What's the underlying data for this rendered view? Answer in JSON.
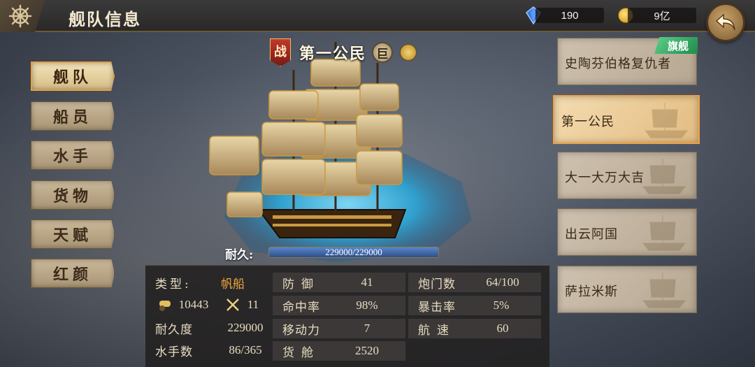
{
  "header": {
    "title": "舰队信息",
    "gems": "190",
    "gold": "9亿"
  },
  "tabs": [
    {
      "label": "舰队",
      "active": true
    },
    {
      "label": "船员",
      "active": false
    },
    {
      "label": "水手",
      "active": false
    },
    {
      "label": "货物",
      "active": false
    },
    {
      "label": "天赋",
      "active": false
    },
    {
      "label": "红颜",
      "active": false
    }
  ],
  "ship": {
    "battle_badge": "战",
    "name": "第一公民",
    "size_badge": "巨",
    "durability_label": "耐久:",
    "durability_text": "229000/229000",
    "durability_fraction": 1.0
  },
  "stats": {
    "type_label": "类型:",
    "type_value": "帆船",
    "power_value": "10443",
    "attack_value": "11",
    "durability_label": "耐久度",
    "durability_value": "229000",
    "sailors_label": "水手数",
    "sailors_value": "86/365",
    "defense_label": "防御",
    "defense_value": "41",
    "hit_label": "命中率",
    "hit_value": "98%",
    "move_label": "移动力",
    "move_value": "7",
    "cargo_label": "货舱",
    "cargo_value": "2520",
    "cannon_label": "炮门数",
    "cannon_value": "64/100",
    "crit_label": "暴击率",
    "crit_value": "5%",
    "speed_label": "航速",
    "speed_value": "60"
  },
  "fleet_list": [
    {
      "name": "史陶芬伯格复仇者",
      "flagship_badge": "旗舰",
      "active": false
    },
    {
      "name": "第一公民",
      "active": true
    },
    {
      "name": "大一大万大吉",
      "active": false
    },
    {
      "name": "出云阿国",
      "active": false
    },
    {
      "name": "萨拉米斯",
      "active": false
    }
  ],
  "colors": {
    "accent_orange": "#f2a640",
    "durability_bar": "#3d68a8",
    "flagship_green": "#2fa860"
  }
}
